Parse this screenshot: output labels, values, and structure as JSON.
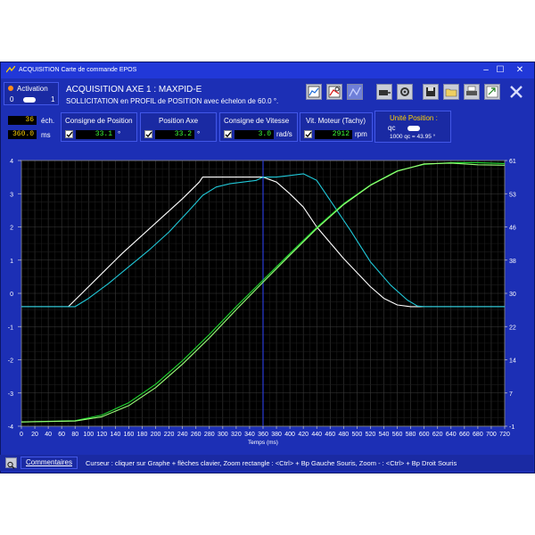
{
  "window": {
    "title": "ACQUISITION Carte de commande EPOS",
    "min_label": "–",
    "max_label": "☐",
    "close_label": "✕"
  },
  "activation": {
    "label": "Activation",
    "off_label": "0",
    "on_label": "1",
    "led_color": "#ff8c1a"
  },
  "header": {
    "line1": "ACQUISITION AXE 1 : MAXPID-E",
    "line2": "SOLLICITATION en PROFIL de POSITION avec échelon de 60.0 °."
  },
  "toolbar": {
    "icons": [
      "graph-icon",
      "graph-zoom-icon",
      "graph-active-icon",
      "motor-icon",
      "settings-icon",
      "save-icon",
      "open-folder-icon",
      "print-icon",
      "export-icon",
      "close-icon"
    ]
  },
  "acquisition": {
    "samples_value": "36",
    "samples_unit": "éch.",
    "duration_value": "360.0",
    "duration_unit": "ms"
  },
  "measures": {
    "consigne_position": {
      "title": "Consigne de Position",
      "value": "33.1",
      "unit": "°"
    },
    "position_axe": {
      "title": "Position Axe",
      "value": "33.2",
      "unit": "°"
    },
    "consigne_vitesse": {
      "title": "Consigne de Vitesse",
      "value": "3.0",
      "unit": "rad/s"
    },
    "vit_moteur": {
      "title": "Vit. Moteur (Tachy)",
      "value": "2912",
      "unit": "rpm"
    }
  },
  "unite_position": {
    "title": "Unité Position :",
    "unit": "qc",
    "conversion": "1000 qc = 43.95 °"
  },
  "chart_data": {
    "type": "line",
    "xlabel": "Temps (ms)",
    "x_ticks": [
      "0",
      "20",
      "40",
      "60",
      "80",
      "100",
      "120",
      "140",
      "160",
      "180",
      "200",
      "220",
      "240",
      "260",
      "280",
      "300",
      "320",
      "340",
      "360",
      "380",
      "400",
      "420",
      "440",
      "460",
      "480",
      "500",
      "520",
      "540",
      "560",
      "580",
      "600",
      "620",
      "640",
      "660",
      "680",
      "700",
      "720"
    ],
    "y_left_ticks": [
      "4",
      "3",
      "2",
      "1",
      "0",
      "-1",
      "-2",
      "-3",
      "-4"
    ],
    "y_right_ticks": [
      "61",
      "53",
      "46",
      "38",
      "30",
      "22",
      "14",
      "7",
      "-1"
    ],
    "xlim": [
      0,
      720
    ],
    "ylim_left": [
      -4,
      4
    ],
    "ylim_right": [
      -1,
      61
    ],
    "grid": true,
    "cursor_x": 360,
    "series": [
      {
        "color": "#ffffff",
        "axis": "left",
        "x": [
          0,
          70,
          90,
          120,
          150,
          180,
          210,
          240,
          255,
          265,
          270,
          340,
          360,
          380,
          400,
          420,
          440,
          480,
          520,
          540,
          560,
          580,
          600,
          610,
          620,
          720
        ],
        "y": [
          -0.4,
          -0.4,
          0.0,
          0.6,
          1.2,
          1.75,
          2.3,
          2.85,
          3.15,
          3.35,
          3.5,
          3.5,
          3.5,
          3.35,
          3.0,
          2.6,
          2.0,
          1.05,
          0.2,
          -0.15,
          -0.35,
          -0.4,
          -0.4,
          -0.4,
          -0.4,
          -0.4
        ]
      },
      {
        "color": "#20c8d8",
        "axis": "left",
        "x": [
          0,
          80,
          100,
          130,
          160,
          190,
          220,
          250,
          270,
          290,
          310,
          330,
          350,
          360,
          380,
          400,
          420,
          440,
          460,
          490,
          520,
          550,
          575,
          590,
          600,
          720
        ],
        "y": [
          -0.4,
          -0.4,
          -0.15,
          0.3,
          0.8,
          1.3,
          1.85,
          2.5,
          2.95,
          3.2,
          3.3,
          3.35,
          3.4,
          3.5,
          3.5,
          3.55,
          3.6,
          3.4,
          2.8,
          1.9,
          0.95,
          0.25,
          -0.2,
          -0.38,
          -0.4,
          -0.4
        ]
      },
      {
        "color": "#20dd30",
        "axis": "right",
        "x": [
          0,
          80,
          120,
          160,
          200,
          240,
          280,
          320,
          360,
          400,
          440,
          480,
          520,
          560,
          600,
          640,
          680,
          720
        ],
        "y": [
          0,
          0.3,
          1.6,
          4.5,
          8.8,
          14.3,
          20.4,
          26.9,
          33.1,
          39.3,
          45.4,
          50.9,
          55.3,
          58.6,
          60.1,
          60.5,
          60.5,
          60.3
        ]
      },
      {
        "color": "#9cff7a",
        "axis": "right",
        "x": [
          0,
          80,
          120,
          160,
          200,
          240,
          280,
          320,
          360,
          400,
          440,
          480,
          520,
          560,
          600,
          640,
          680,
          720
        ],
        "y": [
          0,
          0.2,
          1.2,
          3.8,
          8.0,
          13.5,
          19.6,
          26.2,
          32.6,
          38.9,
          45.1,
          50.7,
          55.2,
          58.5,
          60.2,
          60.4,
          60.0,
          59.9
        ]
      }
    ]
  },
  "status": {
    "commentaires_label": "Commentaires",
    "hint": "Curseur : cliquer sur Graphe + flèches clavier, Zoom rectangle : <Ctrl> + Bp Gauche Souris, Zoom - : <Ctrl> + Bp Droit Souris"
  }
}
